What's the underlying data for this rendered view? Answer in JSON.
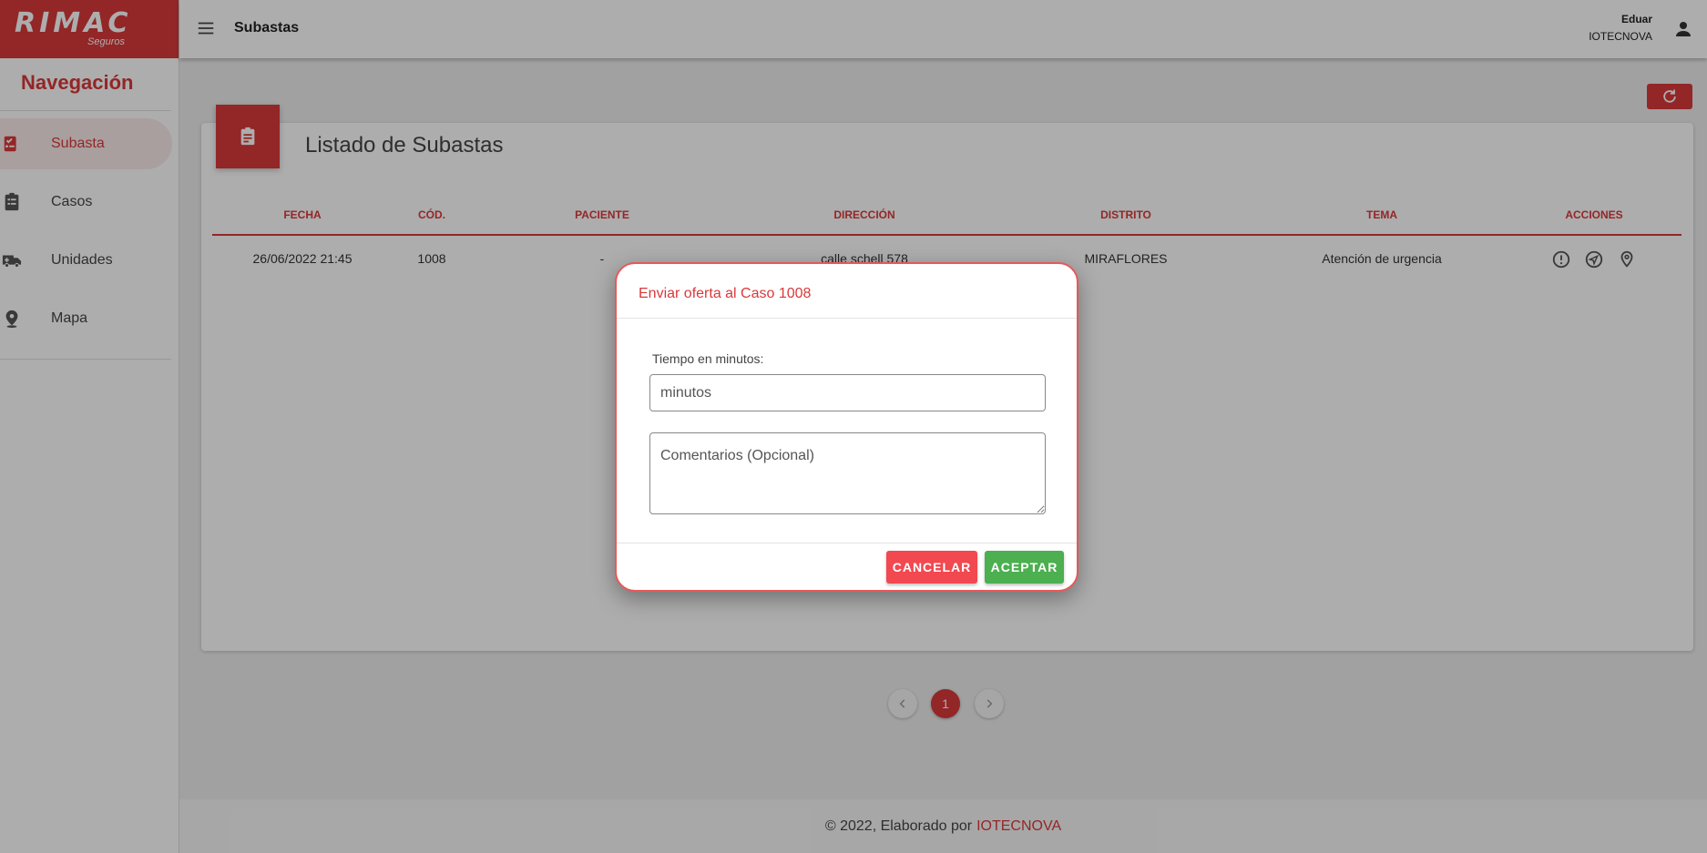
{
  "brand": {
    "name": "RIMAC",
    "sub": "Seguros"
  },
  "sidebar": {
    "title": "Navegación",
    "items": [
      {
        "label": "Subasta",
        "icon": "auction-icon",
        "active": true
      },
      {
        "label": "Casos",
        "icon": "clipboard-list-icon",
        "active": false
      },
      {
        "label": "Unidades",
        "icon": "ambulance-icon",
        "active": false
      },
      {
        "label": "Mapa",
        "icon": "map-pin-icon",
        "active": false
      }
    ]
  },
  "topbar": {
    "title": "Subastas",
    "user_name": "Eduar",
    "user_org": "IOTECNOVA"
  },
  "card": {
    "title": "Listado de Subastas"
  },
  "table": {
    "headers": [
      "FECHA",
      "CÓD.",
      "PACIENTE",
      "DIRECCIÓN",
      "DISTRITO",
      "TEMA",
      "ACCIONES"
    ],
    "rows": [
      {
        "fecha": "26/06/2022 21:45",
        "cod": "1008",
        "paciente": "-",
        "direccion": "calle schell 578",
        "distrito": "MIRAFLORES",
        "tema": "Atención de urgencia"
      }
    ]
  },
  "pagination": {
    "current": "1"
  },
  "footer": {
    "text": "© 2022, Elaborado por",
    "link": "IOTECNOVA"
  },
  "dialog": {
    "title": "Enviar oferta al Caso 1008",
    "label": "Tiempo en minutos:",
    "minutes_placeholder": "minutos",
    "comments_placeholder": "Comentarios (Opcional)",
    "cancel_label": "CANCELAR",
    "accept_label": "ACEPTAR"
  },
  "colors": {
    "accent": "#d9383a",
    "accept": "#4caf50",
    "cancel": "#f2484f"
  }
}
